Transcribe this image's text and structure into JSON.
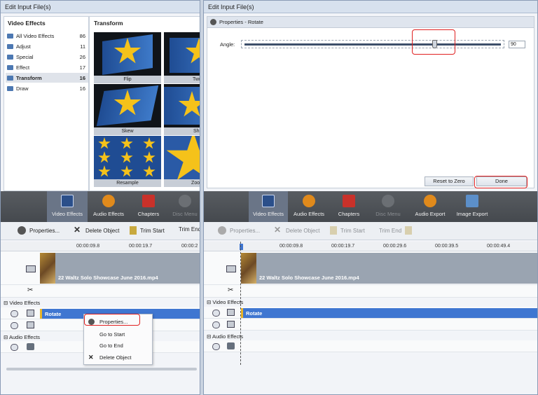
{
  "left": {
    "title": "Edit Input File(s)",
    "categories_header": "Video Effects",
    "gallery_header": "Transform",
    "categories": [
      {
        "label": "All Video Effects",
        "count": "86"
      },
      {
        "label": "Adjust",
        "count": "11"
      },
      {
        "label": "Special",
        "count": "26"
      },
      {
        "label": "Effect",
        "count": "17"
      },
      {
        "label": "Transform",
        "count": "16"
      },
      {
        "label": "Draw",
        "count": "16"
      }
    ],
    "thumbs": [
      "Flip",
      "Twis",
      "Skew",
      "Shif",
      "Resample",
      "Zoom"
    ],
    "toolbar": [
      "Video Effects",
      "Audio Effects",
      "Chapters",
      "Disc Menu"
    ],
    "actions": {
      "properties": "Properties...",
      "delete": "Delete Object",
      "trim_start": "Trim Start",
      "trim_end": "Trim End"
    },
    "ruler": [
      "00:00:09.8",
      "00:00:19.7",
      "00:00:2"
    ],
    "clip_name": "22 Waltz Solo Showcase June 2016.mp4",
    "section_video": "Video Effects",
    "section_audio": "Audio Effects",
    "effect_name": "Rotate",
    "context_menu": [
      "Properties...",
      "Go to Start",
      "Go to End",
      "Delete Object"
    ]
  },
  "right": {
    "title": "Edit Input File(s)",
    "props_title": "Properties - Rotate",
    "angle_label": "Angle:",
    "angle_value": "90",
    "angle_slider_fraction": 0.74,
    "reset_label": "Reset to Zero",
    "done_label": "Done",
    "toolbar": [
      "Video Effects",
      "Audio Effects",
      "Chapters",
      "Disc Menu",
      "Audio Export",
      "Image Export"
    ],
    "actions": {
      "properties": "Properties...",
      "delete": "Delete Object",
      "trim_start": "Trim Start",
      "trim_end": "Trim End"
    },
    "ruler": [
      "00:00:09.8",
      "00:00:19.7",
      "00:00:29.6",
      "00:00:39.5",
      "00:00:49.4"
    ],
    "clip_name": "22 Waltz Solo Showcase June 2016.mp4",
    "section_video": "Video Effects",
    "section_audio": "Audio Effects",
    "effect_name": "Rotate"
  },
  "colors": {
    "accent": "#3f76d1",
    "highlight": "#e02020",
    "toolbar_bg": "#4d5156"
  }
}
